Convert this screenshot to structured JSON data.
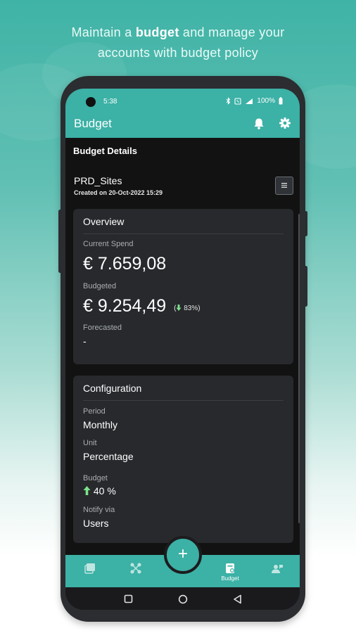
{
  "headline": {
    "prefix": "Maintain a ",
    "bold": "budget",
    "suffix": " and manage your",
    "line2": "accounts with budget policy"
  },
  "status_bar": {
    "time": "5:38",
    "battery": "100%"
  },
  "app_bar": {
    "title": "Budget"
  },
  "budget_details": {
    "title": "Budget Details",
    "name": "PRD_Sites",
    "created": "Created on 20-Oct-2022 15:29"
  },
  "overview": {
    "title": "Overview",
    "current_spend_label": "Current Spend",
    "current_spend_value": "€ 7.659,08",
    "budgeted_label": "Budgeted",
    "budgeted_value": "€ 9.254,49",
    "budgeted_pct": "83%",
    "forecasted_label": "Forecasted",
    "forecasted_value": "-"
  },
  "configuration": {
    "title": "Configuration",
    "period_label": "Period",
    "period_value": "Monthly",
    "unit_label": "Unit",
    "unit_value": "Percentage",
    "budget_label": "Budget",
    "budget_value": "40 %",
    "notify_label": "Notify via",
    "notify_value": "Users"
  },
  "bottom_nav": {
    "budget_label": "Budget",
    "fab_label": "+"
  },
  "colors": {
    "accent": "#3cb1a6",
    "background": "#121212",
    "card": "#27292c",
    "up_arrow": "#7be38a"
  }
}
